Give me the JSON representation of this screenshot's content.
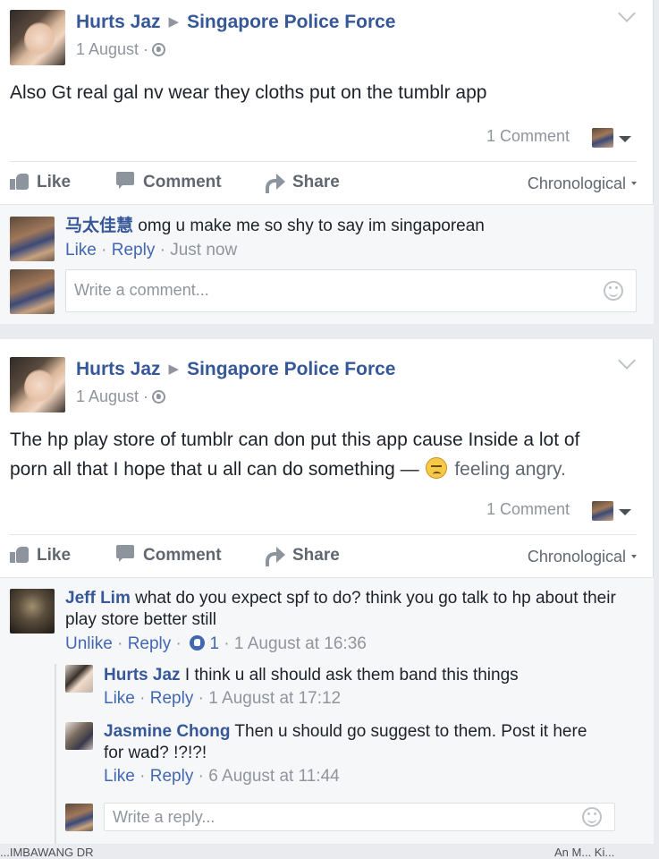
{
  "posts": [
    {
      "author": "Hurts Jaz",
      "target": "Singapore Police Force",
      "date": "1 August ·",
      "text": "Also Gt real gal nv wear they cloths put on the tumblr app",
      "comment_count": "1 Comment",
      "actions": {
        "like": "Like",
        "comment": "Comment",
        "share": "Share"
      },
      "sort": "Chronological",
      "comments": [
        {
          "name": "马太佳慧",
          "text": "omg u make me so shy to say im singaporean",
          "like": "Like",
          "reply": "Reply",
          "time": "Just now"
        }
      ],
      "input_placeholder": "Write a comment..."
    },
    {
      "author": "Hurts Jaz",
      "target": "Singapore Police Force",
      "date": "1 August ·",
      "text_line1": "The hp play store of tumblr can don put this app cause Inside a lot of",
      "text_line2": "porn all that I hope that u all can do something —",
      "feeling": "feeling angry.",
      "comment_count": "1 Comment",
      "actions": {
        "like": "Like",
        "comment": "Comment",
        "share": "Share"
      },
      "sort": "Chronological",
      "comments": [
        {
          "name": "Jeff Lim",
          "text_line1": "what do you expect spf to do? think you go talk to hp about their",
          "text_line2": "play store better still",
          "like": "Unlike",
          "reply": "Reply",
          "reactions": "1",
          "time": "1 August at 16:36"
        },
        {
          "name": "Hurts Jaz",
          "text": "I think u all should ask them band this things",
          "like": "Like",
          "reply": "Reply",
          "time": "1 August at 17:12"
        },
        {
          "name": "Jasmine Chong",
          "text_line1": "Then u should go suggest to them. Post it here",
          "text_line2": "for wad? !?!?!",
          "like": "Like",
          "reply": "Reply",
          "time": "6 August at 11:44"
        }
      ],
      "reply_placeholder": "Write a reply..."
    }
  ],
  "bottom_strip": {
    "left": "...IMBAWANG DR",
    "right": "An M... Ki..."
  }
}
